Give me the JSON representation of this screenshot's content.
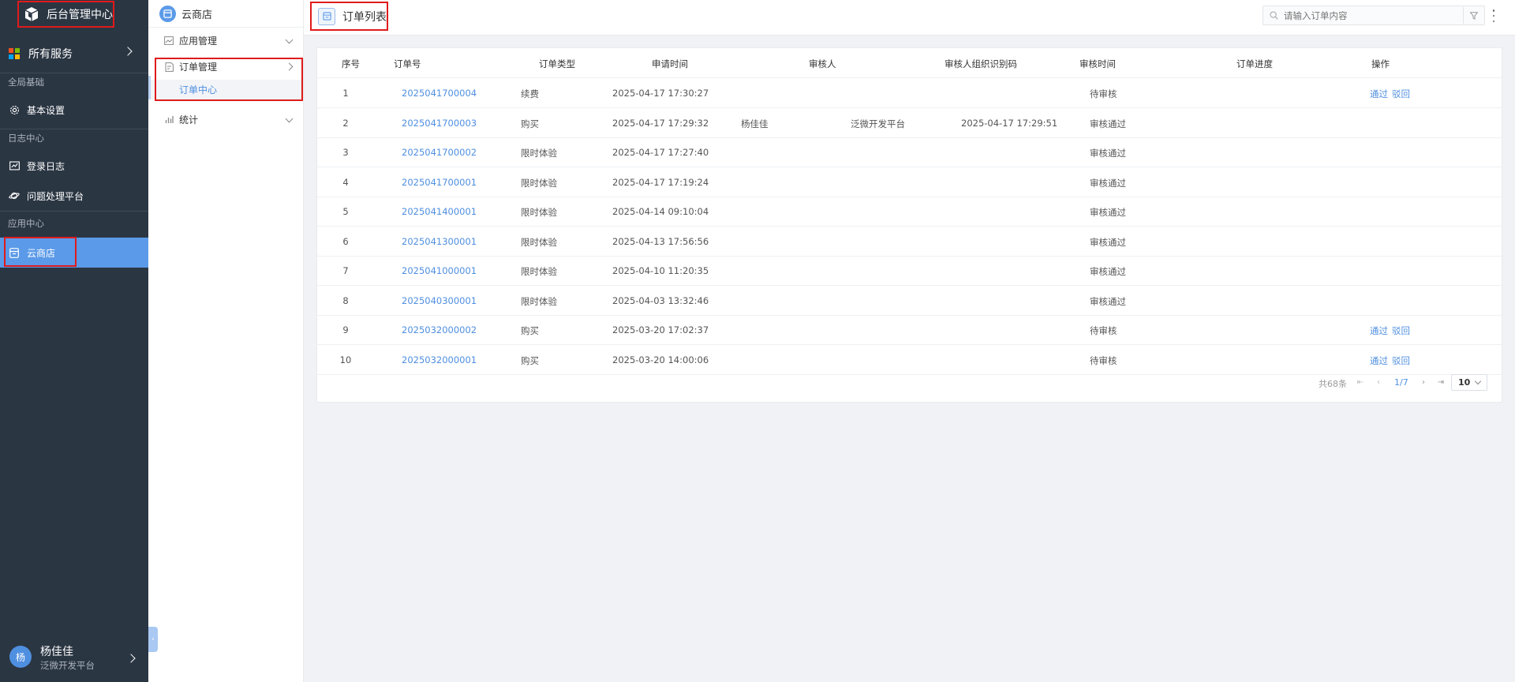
{
  "sidebar": {
    "brand": "后台管理中心",
    "all_services": "所有服务",
    "groups": [
      {
        "title": "全局基础",
        "items": [
          "基本设置"
        ]
      },
      {
        "title": "日志中心",
        "items": [
          "登录日志",
          "问题处理平台"
        ]
      },
      {
        "title": "应用中心",
        "items": [
          "云商店"
        ]
      }
    ],
    "user": {
      "avatar": "杨",
      "name": "杨佳佳",
      "org": "泛微开发平台"
    }
  },
  "subnav": {
    "title": "云商店",
    "items": [
      {
        "label": "应用管理",
        "icon": "image-icon"
      },
      {
        "label": "订单管理",
        "icon": "order-icon",
        "children": [
          "订单中心"
        ]
      },
      {
        "label": "统计",
        "icon": "bar-chart-icon"
      }
    ]
  },
  "topbar": {
    "title": "订单列表",
    "search_placeholder": "请输入订单内容"
  },
  "table": {
    "columns": [
      "序号",
      "订单号",
      "订单类型",
      "申请时间",
      "审核人",
      "审核人组织识别码",
      "审核时间",
      "订单进度",
      "操作"
    ],
    "rows": [
      {
        "no": "1",
        "order": "2025041700004",
        "type": "续费",
        "time": "2025-04-17 17:30:27",
        "reviewer": "",
        "code": "",
        "review_time": "",
        "status": "待审核",
        "actions": [
          "通过",
          "驳回"
        ]
      },
      {
        "no": "2",
        "order": "2025041700003",
        "type": "购买",
        "time": "2025-04-17 17:29:32",
        "reviewer": "杨佳佳",
        "code": "泛微开发平台",
        "review_time": "2025-04-17 17:29:51",
        "status": "审核通过",
        "actions": []
      },
      {
        "no": "3",
        "order": "2025041700002",
        "type": "限时体验",
        "time": "2025-04-17 17:27:40",
        "reviewer": "",
        "code": "",
        "review_time": "",
        "status": "审核通过",
        "actions": []
      },
      {
        "no": "4",
        "order": "2025041700001",
        "type": "限时体验",
        "time": "2025-04-17 17:19:24",
        "reviewer": "",
        "code": "",
        "review_time": "",
        "status": "审核通过",
        "actions": []
      },
      {
        "no": "5",
        "order": "2025041400001",
        "type": "限时体验",
        "time": "2025-04-14 09:10:04",
        "reviewer": "",
        "code": "",
        "review_time": "",
        "status": "审核通过",
        "actions": []
      },
      {
        "no": "6",
        "order": "2025041300001",
        "type": "限时体验",
        "time": "2025-04-13 17:56:56",
        "reviewer": "",
        "code": "",
        "review_time": "",
        "status": "审核通过",
        "actions": []
      },
      {
        "no": "7",
        "order": "2025041000001",
        "type": "限时体验",
        "time": "2025-04-10 11:20:35",
        "reviewer": "",
        "code": "",
        "review_time": "",
        "status": "审核通过",
        "actions": []
      },
      {
        "no": "8",
        "order": "2025040300001",
        "type": "限时体验",
        "time": "2025-04-03 13:32:46",
        "reviewer": "",
        "code": "",
        "review_time": "",
        "status": "审核通过",
        "actions": []
      },
      {
        "no": "9",
        "order": "2025032000002",
        "type": "购买",
        "time": "2025-03-20 17:02:37",
        "reviewer": "",
        "code": "",
        "review_time": "",
        "status": "待审核",
        "actions": [
          "通过",
          "驳回"
        ]
      },
      {
        "no": "10",
        "order": "2025032000001",
        "type": "购买",
        "time": "2025-03-20 14:00:06",
        "reviewer": "",
        "code": "",
        "review_time": "",
        "status": "待审核",
        "actions": [
          "通过",
          "驳回"
        ]
      }
    ]
  },
  "pagination": {
    "total": "共68条",
    "page": "1/7",
    "page_size": "10"
  },
  "colors": {
    "accent": "#4f8fe0",
    "sidebar_bg": "#2b3643",
    "active_bg": "#5b9ae8",
    "highlight_border": "#e01b1b"
  }
}
